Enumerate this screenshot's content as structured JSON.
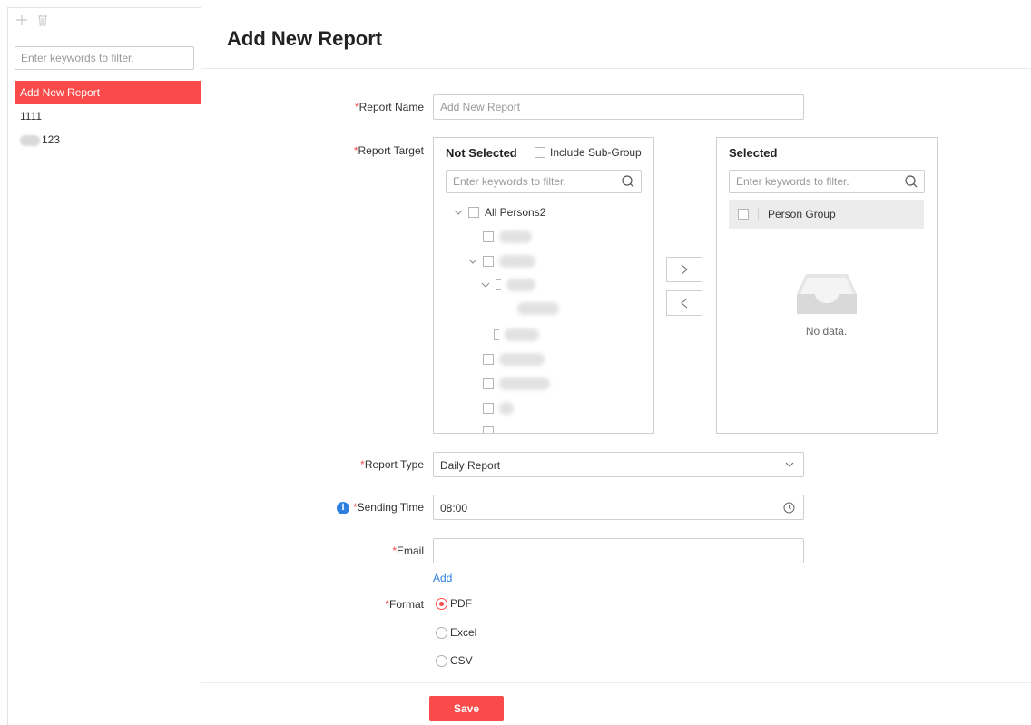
{
  "sidebar": {
    "filter_placeholder": "Enter keywords to filter.",
    "items": [
      {
        "label": "Add New Report",
        "active": true
      },
      {
        "label": "1111"
      },
      {
        "label": "123"
      }
    ]
  },
  "page": {
    "title": "Add New Report"
  },
  "form": {
    "report_name": {
      "required": "*",
      "label": "Report Name",
      "placeholder": "Add New Report",
      "value": ""
    },
    "report_target": {
      "required": "*",
      "label": "Report Target",
      "not_selected": {
        "title": "Not Selected",
        "include_sub_group": "Include Sub-Group",
        "filter_placeholder": "Enter keywords to filter.",
        "root": "All Persons2"
      },
      "selected": {
        "title": "Selected",
        "filter_placeholder": "Enter keywords to filter.",
        "item": "Person Group",
        "empty_text": "No data."
      }
    },
    "report_type": {
      "required": "*",
      "label": "Report Type",
      "value": "Daily Report"
    },
    "sending_time": {
      "required": "*",
      "label": "Sending Time",
      "value": "08:00"
    },
    "email": {
      "required": "*",
      "label": "Email",
      "value": "",
      "add_label": "Add"
    },
    "format": {
      "required": "*",
      "label": "Format",
      "options": [
        {
          "label": "PDF",
          "checked": true
        },
        {
          "label": "Excel",
          "checked": false
        },
        {
          "label": "CSV",
          "checked": false
        }
      ]
    }
  },
  "footer": {
    "save_label": "Save"
  },
  "colors": {
    "accent": "#fa4b4b",
    "link": "#2d80e0",
    "info": "#2d80e0"
  },
  "icons": [
    "add-icon",
    "delete-icon",
    "search-icon",
    "chevron-down-icon",
    "arrow-right-icon",
    "arrow-left-icon",
    "empty-tray-icon",
    "clock-icon",
    "info-icon"
  ]
}
